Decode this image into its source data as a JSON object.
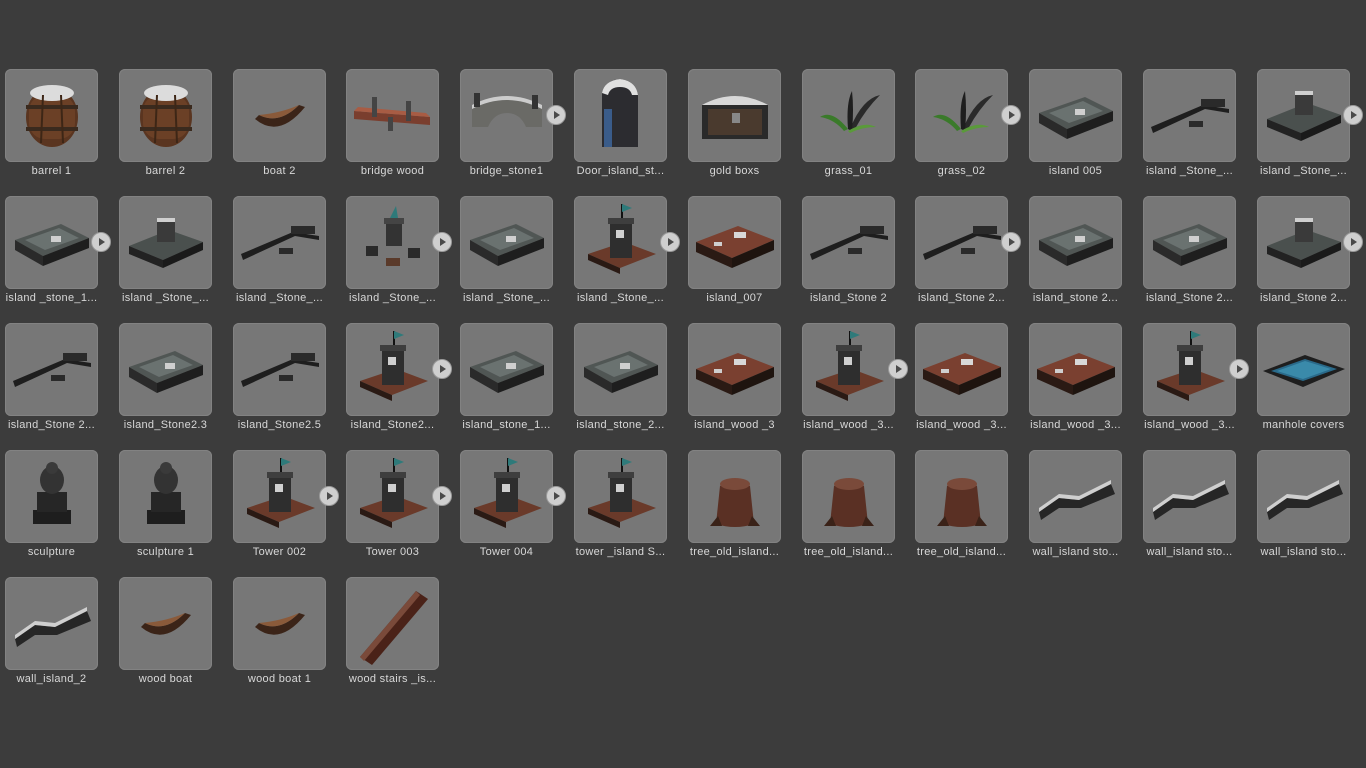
{
  "assets": [
    {
      "label": "barrel 1",
      "icon": "barrel-icon",
      "expandable": false
    },
    {
      "label": "barrel 2",
      "icon": "barrel-icon",
      "expandable": false
    },
    {
      "label": "boat 2",
      "icon": "boat-icon",
      "expandable": false
    },
    {
      "label": "bridge wood",
      "icon": "bridge-wood-icon",
      "expandable": false
    },
    {
      "label": "bridge_stone1",
      "icon": "bridge-stone-icon",
      "expandable": true
    },
    {
      "label": "Door_island_st...",
      "icon": "door-icon",
      "expandable": false
    },
    {
      "label": "gold boxs",
      "icon": "chest-icon",
      "expandable": false
    },
    {
      "label": "grass_01",
      "icon": "grass-icon",
      "expandable": false
    },
    {
      "label": "grass_02",
      "icon": "grass-icon",
      "expandable": true
    },
    {
      "label": "island 005",
      "icon": "stone-platform-icon",
      "expandable": false
    },
    {
      "label": "island _Stone_...",
      "icon": "wall-line-icon",
      "expandable": false
    },
    {
      "label": "island _Stone_...",
      "icon": "stone-ruin-icon",
      "expandable": true
    },
    {
      "label": "island _stone_1...",
      "icon": "stone-platform-icon",
      "expandable": true
    },
    {
      "label": "island _Stone_...",
      "icon": "stone-ruin-icon",
      "expandable": false
    },
    {
      "label": "island _Stone_...",
      "icon": "wall-line-icon",
      "expandable": false
    },
    {
      "label": "island _Stone_...",
      "icon": "tower-parts-icon",
      "expandable": true
    },
    {
      "label": "island _Stone_...",
      "icon": "stone-platform-icon",
      "expandable": false
    },
    {
      "label": "island _Stone_...",
      "icon": "tower-icon",
      "expandable": true
    },
    {
      "label": "island_007",
      "icon": "wood-platform-icon",
      "expandable": false
    },
    {
      "label": "island_Stone 2",
      "icon": "wall-line-icon",
      "expandable": false
    },
    {
      "label": "island_Stone 2...",
      "icon": "wall-line-icon",
      "expandable": true
    },
    {
      "label": "island_stone 2...",
      "icon": "stone-platform-icon",
      "expandable": false
    },
    {
      "label": "island_Stone 2...",
      "icon": "stone-platform-icon",
      "expandable": false
    },
    {
      "label": "island_Stone 2...",
      "icon": "stone-ruin-icon",
      "expandable": true
    },
    {
      "label": "island_Stone 2...",
      "icon": "wall-line-icon",
      "expandable": false
    },
    {
      "label": "island_Stone2.3",
      "icon": "stone-platform-icon",
      "expandable": false
    },
    {
      "label": "island_Stone2.5",
      "icon": "wall-line-icon",
      "expandable": false
    },
    {
      "label": "island_Stone2...",
      "icon": "tower-icon",
      "expandable": true
    },
    {
      "label": "island_stone_1...",
      "icon": "stone-platform-icon",
      "expandable": false
    },
    {
      "label": "island_stone_2...",
      "icon": "stone-platform-icon",
      "expandable": false
    },
    {
      "label": "island_wood _3",
      "icon": "wood-platform-icon",
      "expandable": false
    },
    {
      "label": "island_wood _3...",
      "icon": "tower-icon",
      "expandable": true
    },
    {
      "label": "island_wood _3...",
      "icon": "wood-platform-icon",
      "expandable": false
    },
    {
      "label": "island_wood _3...",
      "icon": "wood-platform-icon",
      "expandable": false
    },
    {
      "label": "island_wood _3...",
      "icon": "tower-icon",
      "expandable": true
    },
    {
      "label": "manhole covers",
      "icon": "manhole-icon",
      "expandable": false
    },
    {
      "label": "sculpture",
      "icon": "sculpture-icon",
      "expandable": false
    },
    {
      "label": "sculpture  1",
      "icon": "sculpture-icon",
      "expandable": false
    },
    {
      "label": "Tower 002",
      "icon": "tower-icon",
      "expandable": true
    },
    {
      "label": "Tower 003",
      "icon": "tower-icon",
      "expandable": true
    },
    {
      "label": "Tower 004",
      "icon": "tower-icon",
      "expandable": true
    },
    {
      "label": "tower _island S...",
      "icon": "tower-icon",
      "expandable": false
    },
    {
      "label": "tree_old_island...",
      "icon": "tree-stump-icon",
      "expandable": false
    },
    {
      "label": "tree_old_island...",
      "icon": "tree-stump-icon",
      "expandable": false
    },
    {
      "label": "tree_old_island...",
      "icon": "tree-stump-icon",
      "expandable": false
    },
    {
      "label": "wall_island sto...",
      "icon": "wall-icon",
      "expandable": false
    },
    {
      "label": "wall_island sto...",
      "icon": "wall-icon",
      "expandable": false
    },
    {
      "label": "wall_island sto...",
      "icon": "wall-icon",
      "expandable": false
    },
    {
      "label": "wall_island_2",
      "icon": "wall-icon",
      "expandable": false
    },
    {
      "label": "wood boat",
      "icon": "boat-icon",
      "expandable": false
    },
    {
      "label": "wood boat 1",
      "icon": "boat-icon",
      "expandable": false
    },
    {
      "label": "wood stairs _is...",
      "icon": "stairs-icon",
      "expandable": false
    }
  ]
}
